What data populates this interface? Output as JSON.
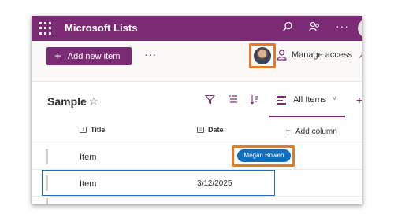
{
  "suite_bar": {
    "app_title": "Microsoft Lists",
    "icons": [
      "waffle-icon",
      "search-icon",
      "share-people-icon",
      "more-icon",
      "profile-avatar"
    ],
    "color": "#7a2b73"
  },
  "command_bar": {
    "new_item_label": "Add new item",
    "new_item_icon": "+",
    "more_label": "···",
    "manage_access_label": "Manage access"
  },
  "list_header": {
    "list_name": "Sample",
    "favorite_icon": "☆",
    "view_label": "All Items",
    "view_chevron": "˅",
    "add_view_icon": "+"
  },
  "columns": [
    {
      "label": "Title",
      "icon": "T"
    },
    {
      "label": "Date",
      "icon": "≡"
    }
  ],
  "add_column_label": "Add column",
  "rows": [
    {
      "title": "Item",
      "date": ""
    },
    {
      "title": "Item",
      "date": "3/12/2025",
      "selected": true
    }
  ],
  "person_tag": "Megan Bowen",
  "colors": {
    "accent": "#7a2b73",
    "highlight": "#e07b2e",
    "selection": "#1a6fc4",
    "person_tag": "#106ebe"
  }
}
